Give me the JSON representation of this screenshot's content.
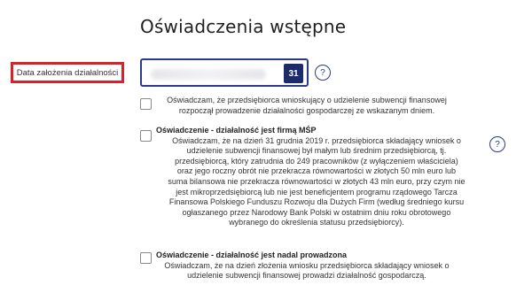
{
  "heading": "Oświadczenia wstępne",
  "date_field": {
    "label": "Data założenia działalności",
    "calendar_button_label": "31"
  },
  "help_label": "?",
  "statements": [
    {
      "title": "",
      "lines": [
        "Oświadczam, że przedsiębiorca wnioskujący o udzielenie subwencji finansowej",
        "rozpoczął prowadzenie działalności gospodarczej ze wskazanym dniem."
      ]
    },
    {
      "title": "Oświadczenie - działalność jest firmą MŚP",
      "lines": [
        "Oświadczam, że na dzień 31 grudnia 2019 r. przedsiębiorca składający wniosek o",
        "udzielenie subwencji finansowej był małym lub średnim przedsiębiorcą, tj.",
        "przedsiębiorcą, który zatrudnia do 249 pracowników (z wyłączeniem właściciela)",
        "oraz jego roczny obrót nie przekracza równowartości w złotych 50 mln euro lub",
        "suma bilansowa nie przekracza równowartości w złotych 43 mln euro, przy czym nie",
        "jest mikroprzedsiębiorcą lub nie jest beneficjentem programu rządowego Tarcza",
        "Finansowa Polskiego Funduszu Rozwoju dla Dużych Firm (według średniego kursu",
        "ogłaszanego przez Narodowy Bank Polski w ostatnim dniu roku obrotowego",
        "wybranego do określenia statusu przedsiębiorcy)."
      ]
    },
    {
      "title": "Oświadczenie - działalność jest nadal prowadzona",
      "lines": [
        "Oświadczam, że na dzień złożenia wniosku przedsiębiorca składający wniosek o",
        "udzielenie subwencji finansowej prowadzi działalność gospodarczą."
      ]
    }
  ]
}
